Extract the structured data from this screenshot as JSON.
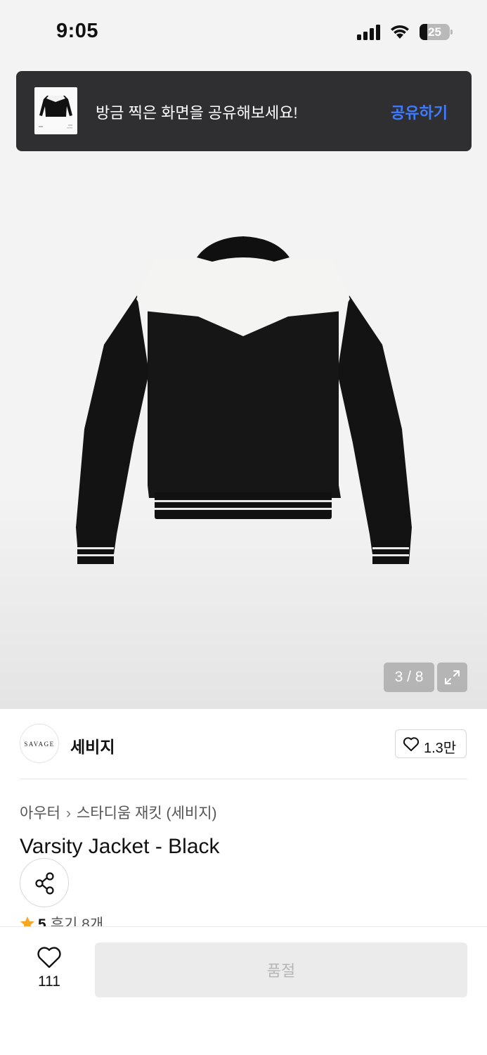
{
  "status_bar": {
    "time": "9:05",
    "battery_level": "25",
    "battery_fraction": 0.25
  },
  "share_toast": {
    "message": "방금 찍은 화면을 공유해보세요!",
    "action_label": "공유하기",
    "accent_color": "#3d7bff"
  },
  "gallery": {
    "current": "3",
    "total": "8",
    "counter": "3 / 8",
    "expand_icon": "expand-icon"
  },
  "brand": {
    "logo_text": "SAVAGE",
    "name": "세비지",
    "like_count": "1.3만"
  },
  "breadcrumb": {
    "category": "아우터",
    "subcategory": "스타디움 재킷 (세비지)"
  },
  "product": {
    "title": "Varsity Jacket - Black",
    "rating": "5",
    "review_label": "후기 8개",
    "star_color": "#f5a623"
  },
  "bottom_bar": {
    "wish_count": "111",
    "cta_label": "품절"
  }
}
